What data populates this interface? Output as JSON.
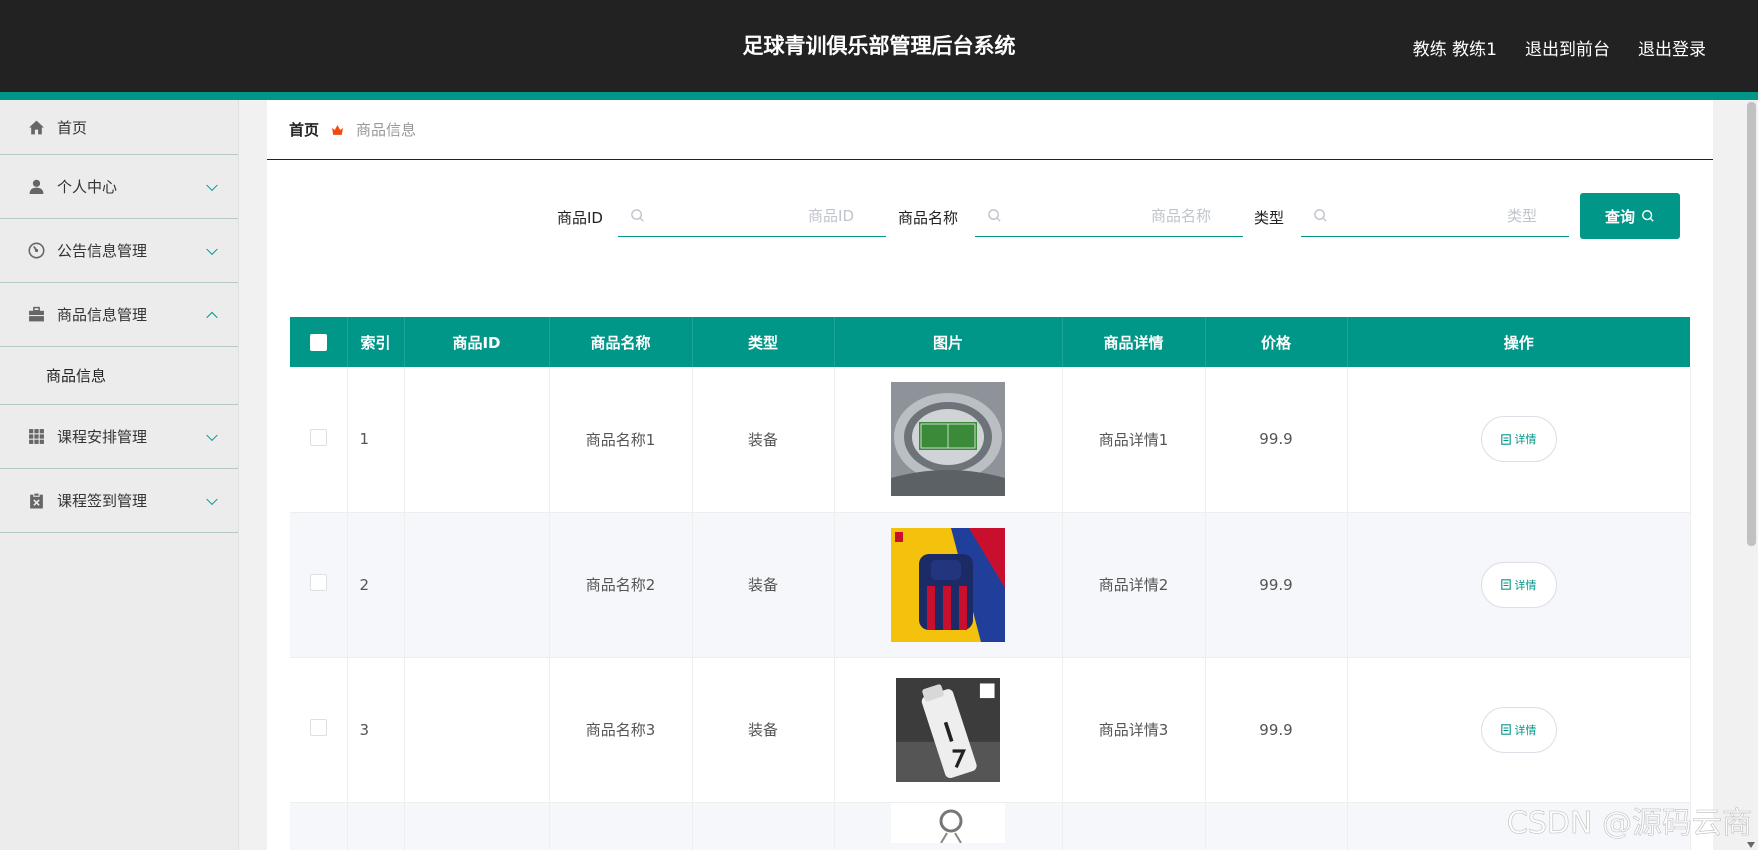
{
  "header": {
    "title": "足球青训俱乐部管理后台系统",
    "user_label": "教练 教练1",
    "to_frontend": "退出到前台",
    "logout": "退出登录"
  },
  "sidebar": {
    "items": [
      {
        "label": "首页",
        "icon": "home-icon"
      },
      {
        "label": "个人中心",
        "icon": "user-icon"
      },
      {
        "label": "公告信息管理",
        "icon": "dashboard-icon"
      },
      {
        "label": "商品信息管理",
        "icon": "briefcase-icon",
        "expanded": true,
        "sub": [
          "商品信息"
        ]
      },
      {
        "label": "课程安排管理",
        "icon": "grid-icon"
      },
      {
        "label": "课程签到管理",
        "icon": "clipboard-icon"
      }
    ]
  },
  "breadcrumb": {
    "home": "首页",
    "current": "商品信息"
  },
  "search": {
    "id_label": "商品ID",
    "id_placeholder": "商品ID",
    "name_label": "商品名称",
    "name_placeholder": "商品名称",
    "type_label": "类型",
    "type_placeholder": "类型",
    "query_button": "查询"
  },
  "table": {
    "headers": [
      "索引",
      "商品ID",
      "商品名称",
      "类型",
      "图片",
      "商品详情",
      "价格",
      "操作"
    ],
    "rows": [
      {
        "index": "1",
        "id": "",
        "name": "商品名称1",
        "type": "装备",
        "image": "stadium-model-image",
        "detail": "商品详情1",
        "price": "99.9",
        "action": "详情"
      },
      {
        "index": "2",
        "id": "",
        "name": "商品名称2",
        "type": "装备",
        "image": "barca-backpack-image",
        "detail": "商品详情2",
        "price": "99.9",
        "action": "详情"
      },
      {
        "index": "3",
        "id": "",
        "name": "商品名称3",
        "type": "装备",
        "image": "juventus-bottle-image",
        "detail": "商品详情3",
        "price": "99.9",
        "action": "详情"
      }
    ]
  },
  "watermark": "CSDN @源码云商",
  "colors": {
    "primary": "#009688",
    "topbar": "#222222",
    "sidebar_bg": "#ececec"
  }
}
